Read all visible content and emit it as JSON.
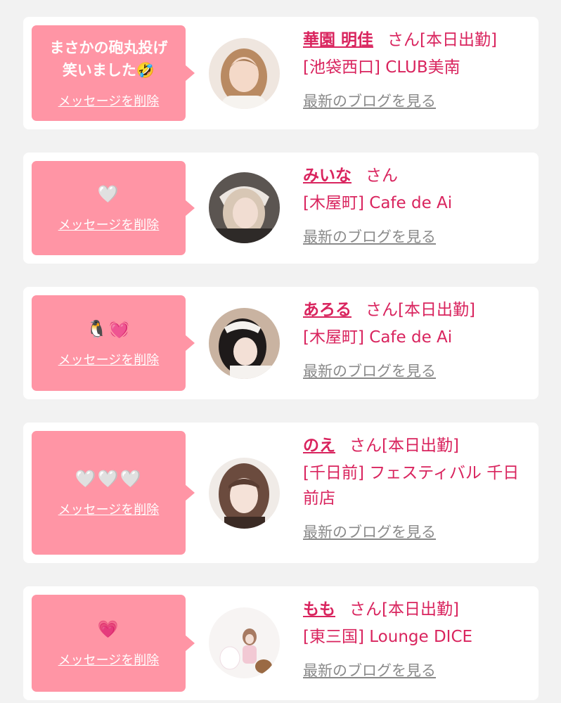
{
  "colors": {
    "accent": "#d9245e",
    "bubble": "#ff95a5",
    "link_gray": "#8a8a8a",
    "background": "#f2f2f2"
  },
  "delete_label": "メッセージを削除",
  "blog_label": "最新のブログを見る",
  "cards": [
    {
      "message": "まさかの砲丸投げ\n笑いました🤣",
      "name": "華園 明佳",
      "suffix": "さん[本日出勤]",
      "shop": "[池袋西口] CLUB美南"
    },
    {
      "message": "🤍",
      "name": "みいな",
      "suffix": "さん",
      "shop": "[木屋町] Cafe de Ai"
    },
    {
      "message": "🐧💓",
      "name": "あろる",
      "suffix": "さん[本日出勤]",
      "shop": "[木屋町] Cafe de Ai"
    },
    {
      "message": "🤍🤍🤍",
      "name": "のえ",
      "suffix": "さん[本日出勤]",
      "shop": "[千日前] フェスティバル 千日前店"
    },
    {
      "message": "💗",
      "name": "もも",
      "suffix": "さん[本日出勤]",
      "shop": "[東三国] Lounge DICE"
    }
  ]
}
